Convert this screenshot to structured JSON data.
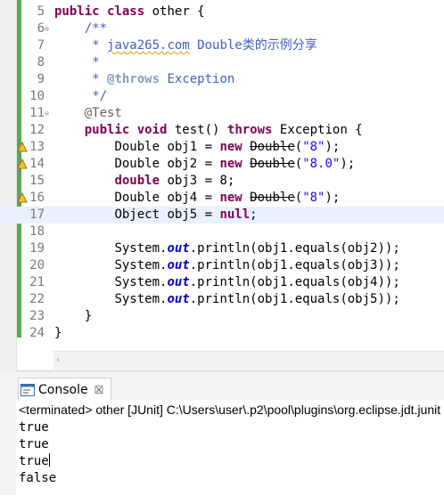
{
  "editor": {
    "lines": [
      {
        "n": "5"
      },
      {
        "n": "6"
      },
      {
        "n": "7"
      },
      {
        "n": "8"
      },
      {
        "n": "9"
      },
      {
        "n": "10"
      },
      {
        "n": "11"
      },
      {
        "n": "12"
      },
      {
        "n": "13"
      },
      {
        "n": "14"
      },
      {
        "n": "15"
      },
      {
        "n": "16"
      },
      {
        "n": "17"
      },
      {
        "n": "18"
      },
      {
        "n": "19"
      },
      {
        "n": "20"
      },
      {
        "n": "21"
      },
      {
        "n": "22"
      },
      {
        "n": "23"
      },
      {
        "n": "24"
      }
    ],
    "fold_glyph": "⊖",
    "tokens": {
      "public": "public",
      "class": "class",
      "class_name": " other {",
      "javadoc_open": "/**",
      "javadoc_site_prefix": " * ",
      "javadoc_site": "java265.com",
      "javadoc_site_rest": " Double类的示例分享",
      "javadoc_star": " *",
      "javadoc_throws_prefix": " * ",
      "javadoc_throws_tag": "@throws",
      "javadoc_throws_rest": " Exception",
      "javadoc_close": " */",
      "annotation": "@Test",
      "void": "void",
      "method_sig": " test() ",
      "throws": "throws",
      "exception_brace": " Exception {",
      "l13_a": "Double obj1 = ",
      "new": "new",
      "sp": " ",
      "Double": "Double",
      "paren_open": "(",
      "str_8": "\"8\"",
      "paren_close_semi": ");",
      "l14_a": "Double obj2 = ",
      "str_8_0": "\"8.0\"",
      "double": "double",
      "l15_rest": " obj3 = 8;",
      "l16_a": "Double obj4 = ",
      "l17_a": "Object obj5 = ",
      "null": "null",
      "semi": ";",
      "sysout": "System.",
      "out": "out",
      "l19_rest": ".println(obj1.equals(obj2));",
      "l20_rest": ".println(obj1.equals(obj3));",
      "l21_rest": ".println(obj1.equals(obj4));",
      "l22_rest": ".println(obj1.equals(obj5));",
      "close_brace": "}"
    }
  },
  "console": {
    "tab_label": "Console",
    "close_glyph": "☒",
    "status": "<terminated> other [JUnit] C:\\Users\\user\\.p2\\pool\\plugins\\org.eclipse.jdt.junit",
    "output": [
      "true",
      "true",
      "true",
      "false"
    ]
  },
  "colors": {
    "keyword": "#7f0055",
    "comment": "#3f5fbf",
    "string": "#2a00ff",
    "annotation": "#646464",
    "static_field": "#0000c0",
    "current_line": "#e8f2fe"
  }
}
